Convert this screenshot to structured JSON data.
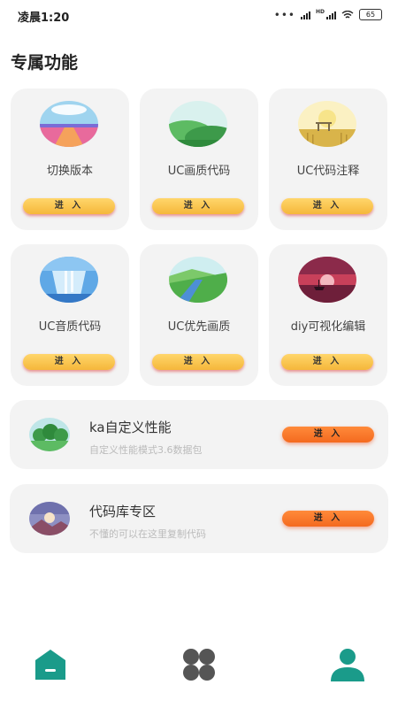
{
  "status_bar": {
    "time": "凌晨1:20",
    "battery": "65",
    "hd": "HD"
  },
  "page_title": "专属功能",
  "grid_items": [
    {
      "label": "切换版本",
      "button": "进 入",
      "icon": "road-sunset-icon"
    },
    {
      "label": "UC画质代码",
      "button": "进 入",
      "icon": "green-hills-icon"
    },
    {
      "label": "UC代码注释",
      "button": "进 入",
      "icon": "wheat-field-icon"
    },
    {
      "label": "UC音质代码",
      "button": "进 入",
      "icon": "waterfall-icon"
    },
    {
      "label": "UC优先画质",
      "button": "进 入",
      "icon": "river-valley-icon"
    },
    {
      "label": "diy可视化编辑",
      "button": "进 入",
      "icon": "sunset-boat-icon"
    }
  ],
  "wide_items": [
    {
      "title": "ka自定义性能",
      "subtitle": "自定义性能模式3.6数据包",
      "button": "进 入",
      "icon": "forest-icon"
    },
    {
      "title": "代码库专区",
      "subtitle": "不懂的可以在这里复制代码",
      "button": "进 入",
      "icon": "mountain-sunrise-icon"
    }
  ],
  "bottom_nav": [
    {
      "name": "home",
      "icon": "home-icon",
      "color": "#1a9b8a"
    },
    {
      "name": "apps",
      "icon": "grid-icon",
      "color": "#555555"
    },
    {
      "name": "profile",
      "icon": "person-icon",
      "color": "#1a9b8a"
    }
  ],
  "colors": {
    "accent": "#1a9b8a",
    "card_bg": "#f3f3f3",
    "yellow_button": "#f8c24e",
    "orange_button": "#f87428"
  }
}
